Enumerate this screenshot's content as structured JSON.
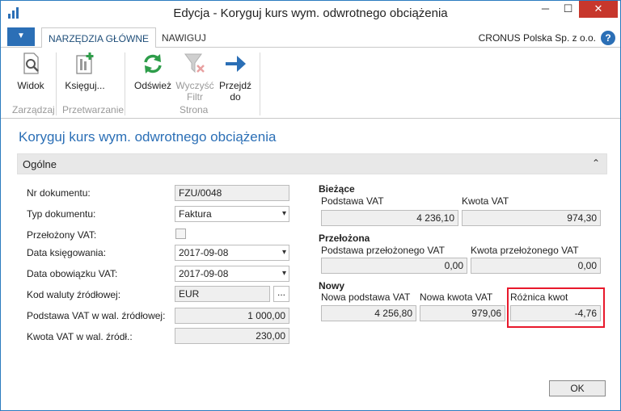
{
  "window": {
    "title": "Edycja - Koryguj kurs wym. odwrotnego obciążenia",
    "minimize_glyph": "─",
    "maximize_glyph": "☐",
    "close_glyph": "✕"
  },
  "ribbon": {
    "app_menu_glyph": "▼",
    "tabs": [
      {
        "label": "NARZĘDZIA GŁÓWNE",
        "active": true
      },
      {
        "label": "NAWIGUJ",
        "active": false
      }
    ],
    "company": "CRONUS Polska Sp. z o.o.",
    "help_glyph": "?",
    "buttons": {
      "view": {
        "label": "Widok",
        "icon": "view-icon"
      },
      "post": {
        "label": "Księguj...",
        "icon": "post-icon"
      },
      "refresh": {
        "label": "Odśwież",
        "icon": "refresh-icon"
      },
      "clear_filter": {
        "label_1": "Wyczyść",
        "label_2": "Filtr",
        "icon": "clear-filter-icon",
        "enabled": false
      },
      "goto": {
        "label_1": "Przejdź",
        "label_2": "do",
        "icon": "arrow-right-icon"
      }
    },
    "groups": {
      "manage": "Zarządzaj",
      "process": "Przetwarzanie",
      "page": "Strona"
    }
  },
  "page": {
    "title": "Koryguj kurs wym. odwrotnego obciążenia",
    "fasttab": {
      "label": "Ogólne",
      "chevron": "⌃"
    }
  },
  "general": {
    "doc_no": {
      "label": "Nr dokumentu:",
      "value": "FZU/0048"
    },
    "doc_type": {
      "label": "Typ dokumentu:",
      "value": "Faktura"
    },
    "vat_translated": {
      "label": "Przełożony VAT:",
      "checked": false
    },
    "posting_date": {
      "label": "Data księgowania:",
      "value": "2017-09-08"
    },
    "vat_date": {
      "label": "Data obowiązku VAT:",
      "value": "2017-09-08"
    },
    "currency": {
      "label": "Kod waluty źródłowej:",
      "value": "EUR",
      "lookup": "..."
    },
    "vat_base_src": {
      "label": "Podstawa VAT w wal. źródłowej:",
      "value": "1 000,00"
    },
    "vat_amount_src": {
      "label": "Kwota VAT w wal. źródł.:",
      "value": "230,00"
    }
  },
  "current": {
    "heading": "Bieżące",
    "base_label": "Podstawa VAT",
    "amount_label": "Kwota VAT",
    "base_value": "4 236,10",
    "amount_value": "974,30"
  },
  "translated": {
    "heading": "Przełożona",
    "base_label": "Podstawa przełożonego VAT",
    "amount_label": "Kwota przełożonego VAT",
    "base_value": "0,00",
    "amount_value": "0,00"
  },
  "new": {
    "heading": "Nowy",
    "base_label": "Nowa podstawa VAT",
    "amount_label": "Nowa kwota VAT",
    "diff_label": "Różnica kwot",
    "base_value": "4 256,80",
    "amount_value": "979,06",
    "diff_value": "-4,76"
  },
  "footer": {
    "ok_label": "OK"
  },
  "colors": {
    "accent": "#2b6fb6",
    "close": "#c7372c",
    "highlight": "#e8192c"
  }
}
